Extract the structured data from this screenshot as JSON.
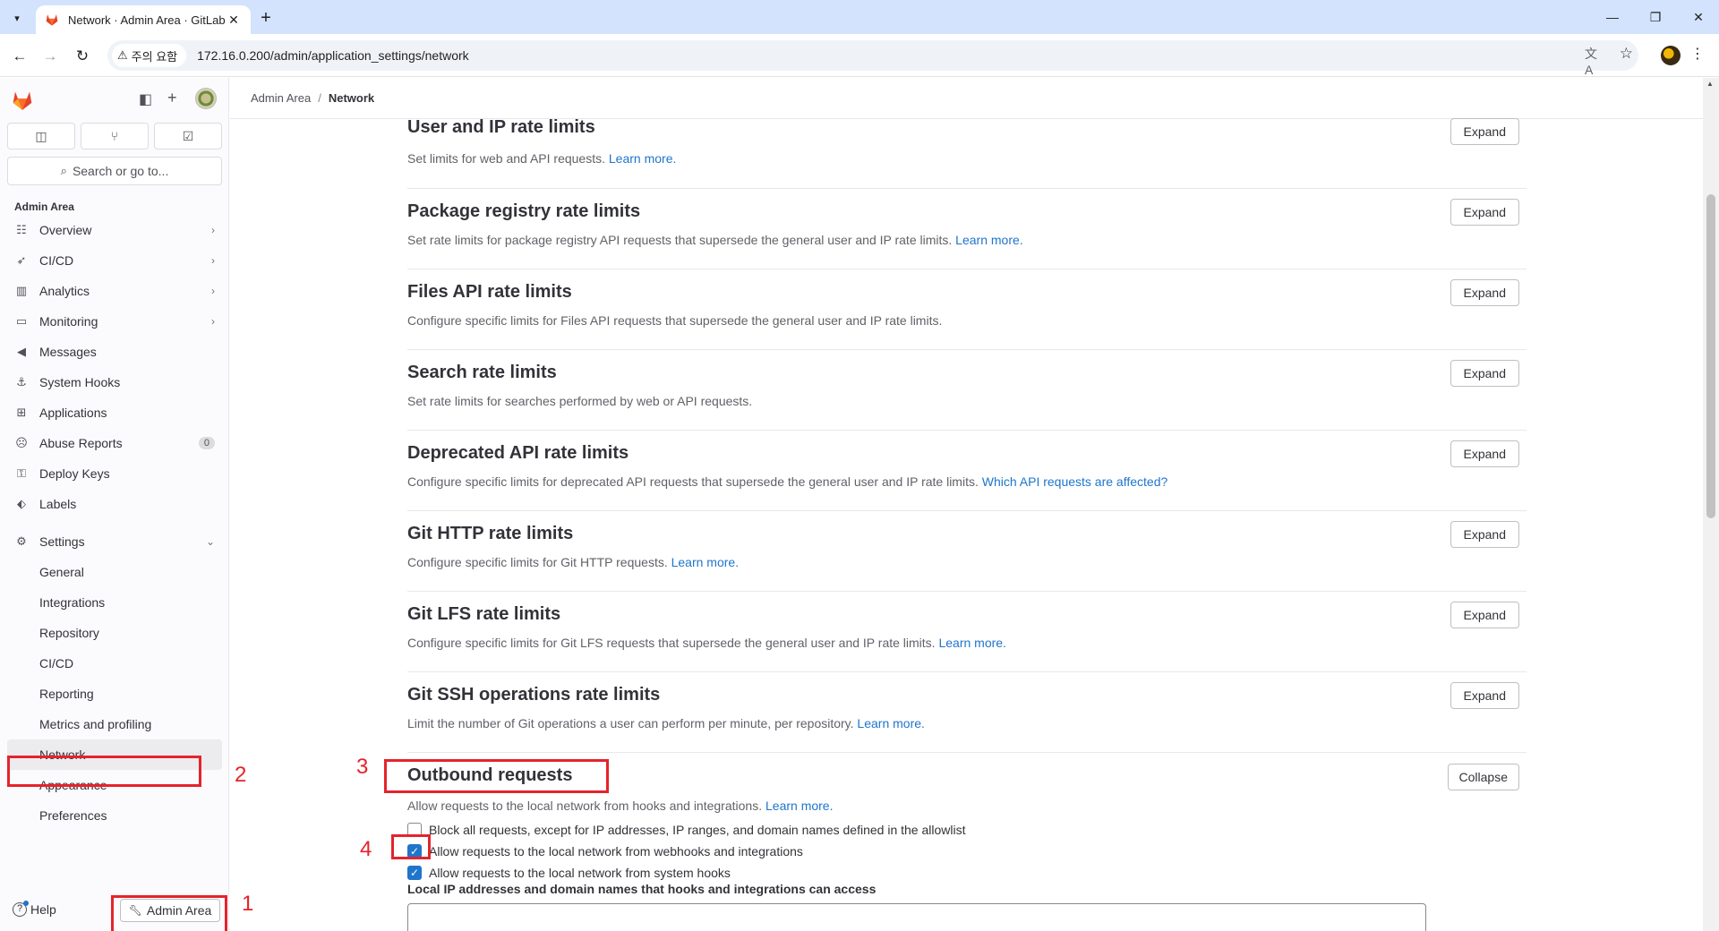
{
  "browser": {
    "tab_title": "Network · Admin Area · GitLab",
    "security_label": "주의 요함",
    "url": "172.16.0.200/admin/application_settings/network"
  },
  "sidebar": {
    "search_placeholder": "Search or go to...",
    "section_heading": "Admin Area",
    "items": [
      {
        "label": "Overview",
        "icon": "overview-icon",
        "chevron": true
      },
      {
        "label": "CI/CD",
        "icon": "rocket-icon",
        "chevron": true
      },
      {
        "label": "Analytics",
        "icon": "chart-icon",
        "chevron": true
      },
      {
        "label": "Monitoring",
        "icon": "monitor-icon",
        "chevron": true
      },
      {
        "label": "Messages",
        "icon": "bullhorn-icon"
      },
      {
        "label": "System Hooks",
        "icon": "anchor-icon"
      },
      {
        "label": "Applications",
        "icon": "applications-icon"
      },
      {
        "label": "Abuse Reports",
        "icon": "abuse-icon",
        "badge": "0"
      },
      {
        "label": "Deploy Keys",
        "icon": "key-icon"
      },
      {
        "label": "Labels",
        "icon": "label-icon"
      }
    ],
    "settings": {
      "label": "Settings",
      "items": [
        "General",
        "Integrations",
        "Repository",
        "CI/CD",
        "Reporting",
        "Metrics and profiling",
        "Network",
        "Appearance",
        "Preferences"
      ],
      "active": "Network"
    },
    "help_label": "Help",
    "admin_area_button": "Admin Area"
  },
  "breadcrumb": {
    "parent": "Admin Area",
    "current": "Network"
  },
  "sections": [
    {
      "title": "User and IP rate limits",
      "description": "Set limits for web and API requests.",
      "link": "Learn more.",
      "button": "Expand"
    },
    {
      "title": "Package registry rate limits",
      "description": "Set rate limits for package registry API requests that supersede the general user and IP rate limits.",
      "link": "Learn more.",
      "button": "Expand"
    },
    {
      "title": "Files API rate limits",
      "description": "Configure specific limits for Files API requests that supersede the general user and IP rate limits.",
      "link": "",
      "button": "Expand"
    },
    {
      "title": "Search rate limits",
      "description": "Set rate limits for searches performed by web or API requests.",
      "link": "",
      "button": "Expand"
    },
    {
      "title": "Deprecated API rate limits",
      "description": "Configure specific limits for deprecated API requests that supersede the general user and IP rate limits.",
      "link": "Which API requests are affected?",
      "button": "Expand"
    },
    {
      "title": "Git HTTP rate limits",
      "description": "Configure specific limits for Git HTTP requests.",
      "link": "Learn more.",
      "button": "Expand"
    },
    {
      "title": "Git LFS rate limits",
      "description": "Configure specific limits for Git LFS requests that supersede the general user and IP rate limits.",
      "link": "Learn more.",
      "button": "Expand"
    },
    {
      "title": "Git SSH operations rate limits",
      "description": "Limit the number of Git operations a user can perform per minute, per repository.",
      "link": "Learn more.",
      "button": "Expand"
    }
  ],
  "outbound": {
    "title": "Outbound requests",
    "button": "Collapse",
    "description": "Allow requests to the local network from hooks and integrations.",
    "link": "Learn more.",
    "checkboxes": [
      {
        "label": "Block all requests, except for IP addresses, IP ranges, and domain names defined in the allowlist",
        "checked": false
      },
      {
        "label": "Allow requests to the local network from webhooks and integrations",
        "checked": true
      },
      {
        "label": "Allow requests to the local network from system hooks",
        "checked": true
      }
    ],
    "allowlist_label": "Local IP addresses and domain names that hooks and integrations can access"
  },
  "annotations": [
    "1",
    "2",
    "3",
    "4"
  ],
  "colors": {
    "annotation": "#e5232b",
    "link": "#1f75cb",
    "checkbox_checked": "#1f75cb",
    "chrome_tabbar": "#d3e3fd"
  }
}
